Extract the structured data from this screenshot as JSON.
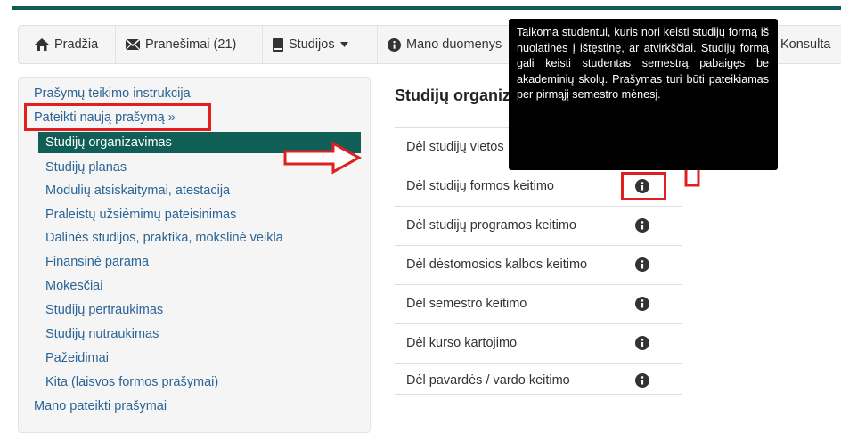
{
  "navbar": {
    "items": [
      {
        "label": "Pradžia",
        "icon": "home-icon"
      },
      {
        "label": "Pranešimai (21)",
        "icon": "envelope-icon"
      },
      {
        "label": "Studijos",
        "icon": "book-icon"
      },
      {
        "label": "Mano duomenys",
        "icon": "info-circle-icon"
      },
      {
        "label": "Konsulta"
      }
    ]
  },
  "sidebar": {
    "instructions": "Prašymų teikimo instrukcija",
    "submit_new": "Pateikti naują prašymą »",
    "active": "Studijų organizavimas",
    "items": [
      "Studijų planas",
      "Modulių atsiskaitymai, atestacija",
      "Praleistų užsiėmimų pateisinimas",
      "Dalinės studijos, praktika, mokslinė veikla",
      "Finansinė parama",
      "Mokesčiai",
      "Studijų pertraukimas",
      "Studijų nutraukimas",
      "Pažeidimai",
      "Kita (laisvos formos prašymai)"
    ],
    "my_requests": "Mano pateikti prašymai"
  },
  "main": {
    "title": "Studijų organizavimas",
    "rows": [
      "Dėl studijų vietos",
      "Dėl studijų formos keitimo",
      "Dėl studijų programos keitimo",
      "Dėl dėstomosios kalbos keitimo",
      "Dėl semestro keitimo",
      "Dėl kurso kartojimo",
      "Dėl pavardės / vardo keitimo"
    ]
  },
  "tooltip": {
    "text": "Taikoma studentui, kuris nori keisti studijų formą iš nuolatinės į ištęstinę, ar atvirkščiai. Studijų formą gali keisti studentas semestrą pabaigęs be akademinių skolų. Prašymas turi būti pateikiamas per pirmąjį semestro mėnesį."
  },
  "colors": {
    "brand": "#0f5f56",
    "link": "#2a6496",
    "annotation": "#e02020",
    "tooltip_bg": "#000000"
  }
}
